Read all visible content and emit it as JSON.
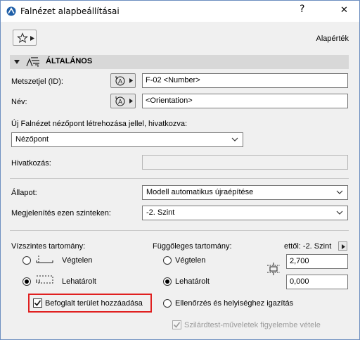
{
  "window": {
    "title": "Falnézet alapbeállításai",
    "help": "?",
    "close": "✕"
  },
  "toolbar": {
    "default_label": "Alapérték"
  },
  "section": {
    "title": "ÁLTALÁNOS"
  },
  "fields": {
    "id_label": "Metszetjel (ID):",
    "id_value": "F-02 <Number>",
    "name_label": "Név:",
    "name_value": "<Orientation>",
    "create_label": "Új Falnézet nézőpont létrehozása jellel, hivatkozva:",
    "create_value": "Nézőpont",
    "reference_label": "Hivatkozás:",
    "reference_value": ""
  },
  "status": {
    "label": "Állapot:",
    "value": "Modell automatikus újraépítése"
  },
  "display": {
    "label": "Megjelenítés ezen szinteken:",
    "value": "-2. Szint"
  },
  "horizontal": {
    "label": "Vízszintes tartomány:",
    "infinite": "Végtelen",
    "limited": "Lehatárolt",
    "selected": "limited",
    "add_area_label": "Befoglalt terület hozzáadása",
    "add_area_checked": true
  },
  "vertical": {
    "label": "Függőleges tartomány:",
    "from_label": "ettől: -2. Szint",
    "infinite": "Végtelen",
    "limited": "Lehatárolt",
    "selected": "limited",
    "top_value": "2,700",
    "bottom_value": "0,000",
    "fit_label": "Ellenőrzés és helyiséghez igazítás",
    "solid_ops_label": "Szilárdtest-műveletek figyelembe vétele",
    "solid_ops_checked": true
  },
  "colors": {
    "highlight": "#e02020",
    "section_bg": "#d8d8d8"
  }
}
